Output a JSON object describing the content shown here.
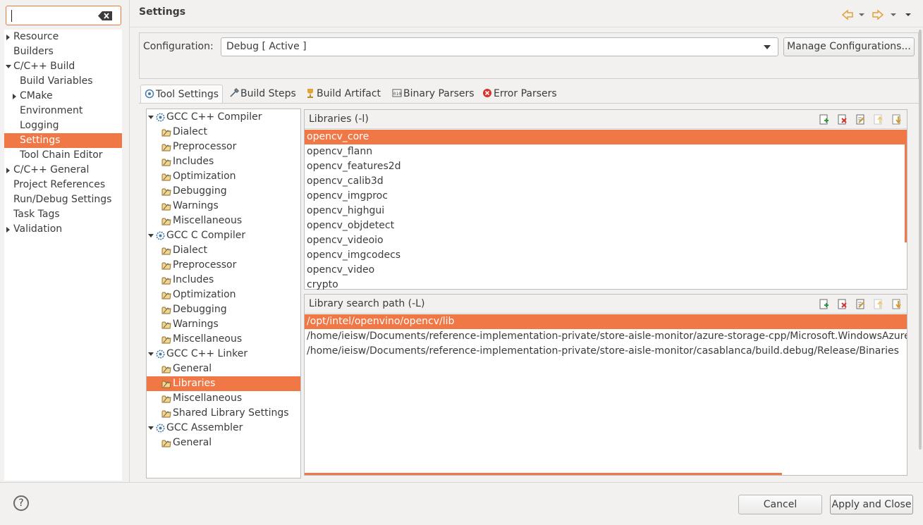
{
  "filter": {
    "value": ""
  },
  "nav": {
    "items": [
      {
        "label": "Resource",
        "arrow": "right",
        "indent": 1
      },
      {
        "label": "Builders",
        "arrow": "",
        "indent": 1
      },
      {
        "label": "C/C++ Build",
        "arrow": "down",
        "indent": 1
      },
      {
        "label": "Build Variables",
        "arrow": "",
        "indent": 2
      },
      {
        "label": "CMake",
        "arrow": "right",
        "indent": 2
      },
      {
        "label": "Environment",
        "arrow": "",
        "indent": 2
      },
      {
        "label": "Logging",
        "arrow": "",
        "indent": 2
      },
      {
        "label": "Settings",
        "arrow": "",
        "indent": 2,
        "selected": true
      },
      {
        "label": "Tool Chain Editor",
        "arrow": "",
        "indent": 2
      },
      {
        "label": "C/C++ General",
        "arrow": "right",
        "indent": 1
      },
      {
        "label": "Project References",
        "arrow": "",
        "indent": 1
      },
      {
        "label": "Run/Debug Settings",
        "arrow": "",
        "indent": 1
      },
      {
        "label": "Task Tags",
        "arrow": "",
        "indent": 1
      },
      {
        "label": "Validation",
        "arrow": "right",
        "indent": 1
      }
    ]
  },
  "header": {
    "title": "Settings"
  },
  "config": {
    "label": "Configuration:",
    "selected": "Debug  [ Active ]",
    "manage_label": "Manage Configurations..."
  },
  "tabs": [
    {
      "label": "Tool Settings",
      "icon": "tool-settings-icon",
      "active": true
    },
    {
      "label": "Build Steps",
      "icon": "build-steps-icon"
    },
    {
      "label": "Build Artifact",
      "icon": "build-artifact-icon"
    },
    {
      "label": "Binary Parsers",
      "icon": "binary-parsers-icon"
    },
    {
      "label": "Error Parsers",
      "icon": "error-parsers-icon"
    }
  ],
  "tree": [
    {
      "label": "GCC C++ Compiler",
      "type": "tool"
    },
    {
      "label": "Dialect",
      "type": "option"
    },
    {
      "label": "Preprocessor",
      "type": "option"
    },
    {
      "label": "Includes",
      "type": "option"
    },
    {
      "label": "Optimization",
      "type": "option"
    },
    {
      "label": "Debugging",
      "type": "option"
    },
    {
      "label": "Warnings",
      "type": "option"
    },
    {
      "label": "Miscellaneous",
      "type": "option"
    },
    {
      "label": "GCC C Compiler",
      "type": "tool"
    },
    {
      "label": "Dialect",
      "type": "option"
    },
    {
      "label": "Preprocessor",
      "type": "option"
    },
    {
      "label": "Includes",
      "type": "option"
    },
    {
      "label": "Optimization",
      "type": "option"
    },
    {
      "label": "Debugging",
      "type": "option"
    },
    {
      "label": "Warnings",
      "type": "option"
    },
    {
      "label": "Miscellaneous",
      "type": "option"
    },
    {
      "label": "GCC C++ Linker",
      "type": "tool"
    },
    {
      "label": "General",
      "type": "option"
    },
    {
      "label": "Libraries",
      "type": "option",
      "selected": true
    },
    {
      "label": "Miscellaneous",
      "type": "option"
    },
    {
      "label": "Shared Library Settings",
      "type": "option"
    },
    {
      "label": "GCC Assembler",
      "type": "tool"
    },
    {
      "label": "General",
      "type": "option"
    }
  ],
  "libraries": {
    "title": "Libraries (-l)",
    "items": [
      "opencv_core",
      "opencv_flann",
      "opencv_features2d",
      "opencv_calib3d",
      "opencv_imgproc",
      "opencv_highgui",
      "opencv_objdetect",
      "opencv_videoio",
      "opencv_imgcodecs",
      "opencv_video",
      "crypto"
    ]
  },
  "search_paths": {
    "title": "Library search path (-L)",
    "items": [
      "/opt/intel/openvino/opencv/lib",
      "/home/ieisw/Documents/reference-implementation-private/store-aisle-monitor/azure-storage-cpp/Microsoft.WindowsAzure.Storage/build.release/Binaries",
      "/home/ieisw/Documents/reference-implementation-private/store-aisle-monitor/casablanca/build.debug/Release/Binaries"
    ]
  },
  "toolbar_icons": [
    "add-icon",
    "delete-icon",
    "edit-icon",
    "move-up-icon",
    "move-down-icon"
  ],
  "footer": {
    "help": "?",
    "cancel_label": "Cancel",
    "apply_label": "Apply and Close"
  },
  "colors": {
    "accent": "#f07746",
    "background": "#f2f1f0"
  }
}
